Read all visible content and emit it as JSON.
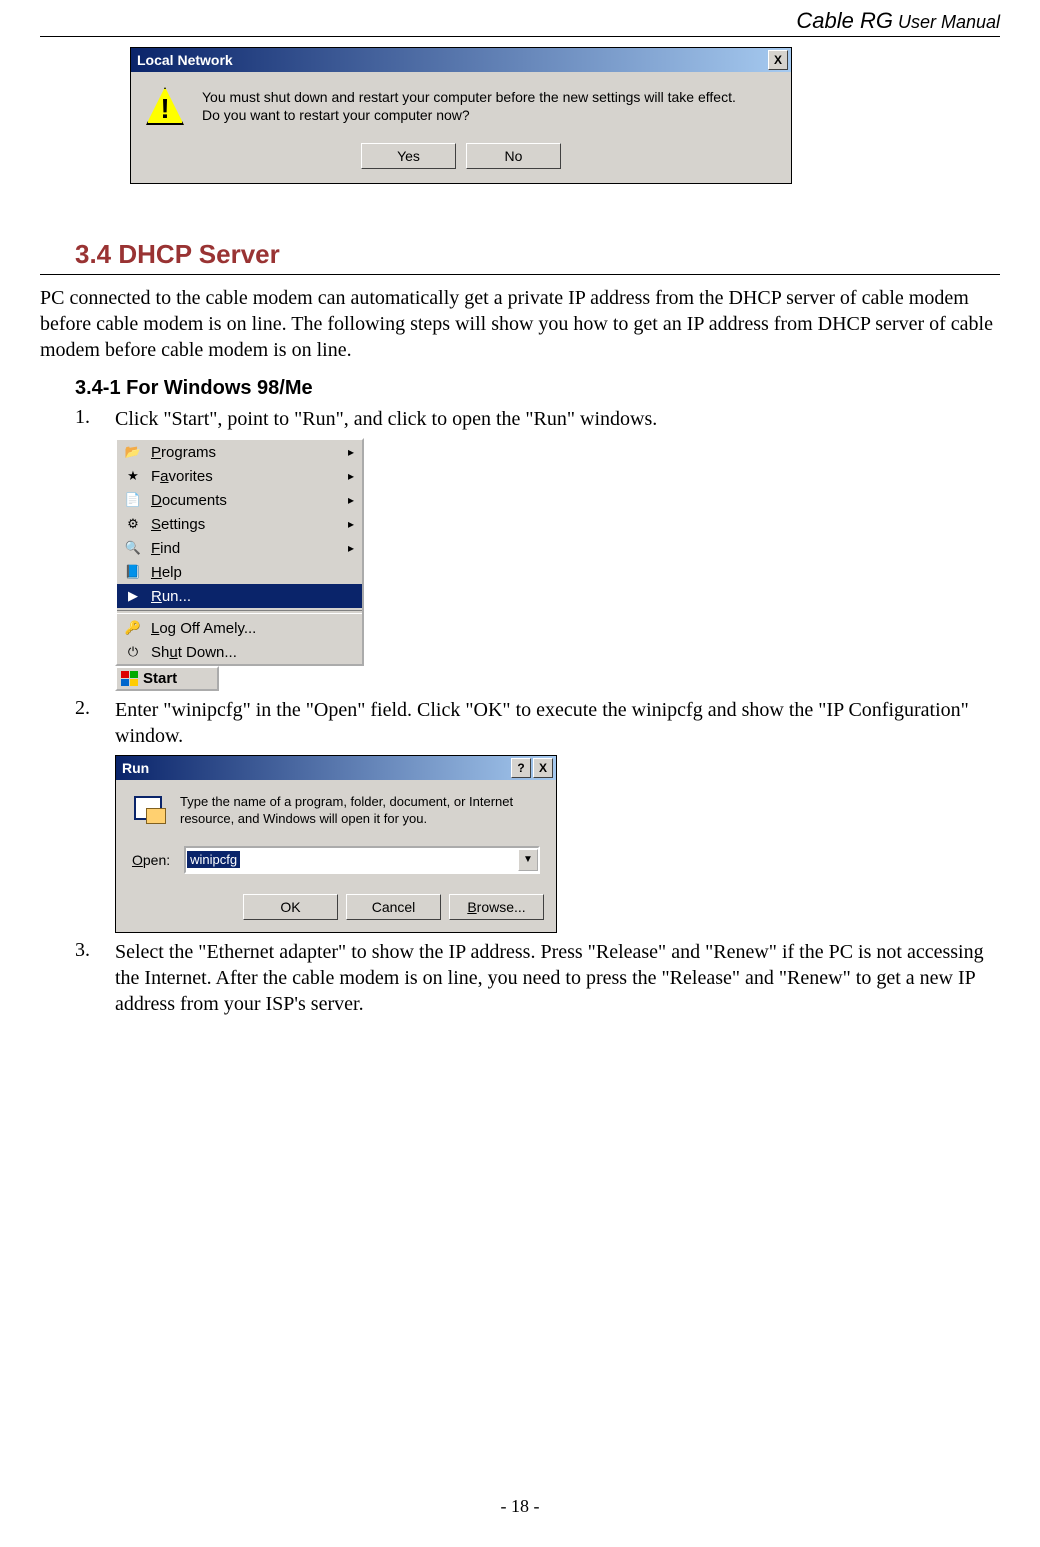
{
  "header": {
    "cable": "Cable RG",
    "user": " User Manual"
  },
  "dialog1": {
    "title": "Local Network",
    "line1": "You must shut down and restart your computer before the new settings will take effect.",
    "line2": "Do you want to restart your computer now?",
    "yes": "Yes",
    "no": "No",
    "close": "X"
  },
  "section": {
    "heading": "3.4 DHCP Server",
    "para": "PC connected to the cable modem can automatically get a private IP address from the DHCP server of cable modem before cable modem is on line. The following steps will show you how to get an IP address from DHCP server of cable modem before cable modem is on line.",
    "subheading": "3.4-1 For Windows 98/Me"
  },
  "steps": {
    "n1": "1.",
    "t1": "Click \"Start\", point to \"Run\", and click to open the \"Run\" windows.",
    "n2": "2.",
    "t2": "Enter \"winipcfg\" in the \"Open\" field. Click \"OK\" to execute the winipcfg and show the \"IP Configuration\" window.",
    "n3": "3.",
    "t3": "Select the \"Ethernet adapter\" to show the IP address. Press \"Release\" and \"Renew\" if the PC is not accessing the Internet. After the cable modem is on line, you need to press the \"Release\" and \"Renew\" to get a new IP address from your ISP's server."
  },
  "startmenu": {
    "items": [
      {
        "icon": "📂",
        "label_pre": "",
        "u": "P",
        "label_post": "rograms",
        "sub": true
      },
      {
        "icon": "★",
        "label_pre": "F",
        "u": "a",
        "label_post": "vorites",
        "sub": true
      },
      {
        "icon": "📄",
        "label_pre": "",
        "u": "D",
        "label_post": "ocuments",
        "sub": true
      },
      {
        "icon": "⚙",
        "label_pre": "",
        "u": "S",
        "label_post": "ettings",
        "sub": true
      },
      {
        "icon": "🔍",
        "label_pre": "",
        "u": "F",
        "label_post": "ind",
        "sub": true
      },
      {
        "icon": "📘",
        "label_pre": "",
        "u": "H",
        "label_post": "elp",
        "sub": false
      },
      {
        "icon": "▶",
        "label_pre": "",
        "u": "R",
        "label_post": "un...",
        "sub": false,
        "selected": true
      },
      {
        "sep": true
      },
      {
        "icon": "🔑",
        "label_pre": "",
        "u": "L",
        "label_post": "og Off Amely...",
        "sub": false
      },
      {
        "icon": "⏻",
        "label_pre": "Sh",
        "u": "u",
        "label_post": "t Down...",
        "sub": false
      }
    ],
    "start": "Start"
  },
  "run": {
    "title": "Run",
    "help": "?",
    "close": "X",
    "desc": "Type the name of a program, folder, document, or Internet resource, and Windows will open it for you.",
    "open_u": "O",
    "open_label": "pen:",
    "value": "winipcfg",
    "ok": "OK",
    "cancel": "Cancel",
    "browse_u": "B",
    "browse": "rowse..."
  },
  "footer": "- 18 -"
}
